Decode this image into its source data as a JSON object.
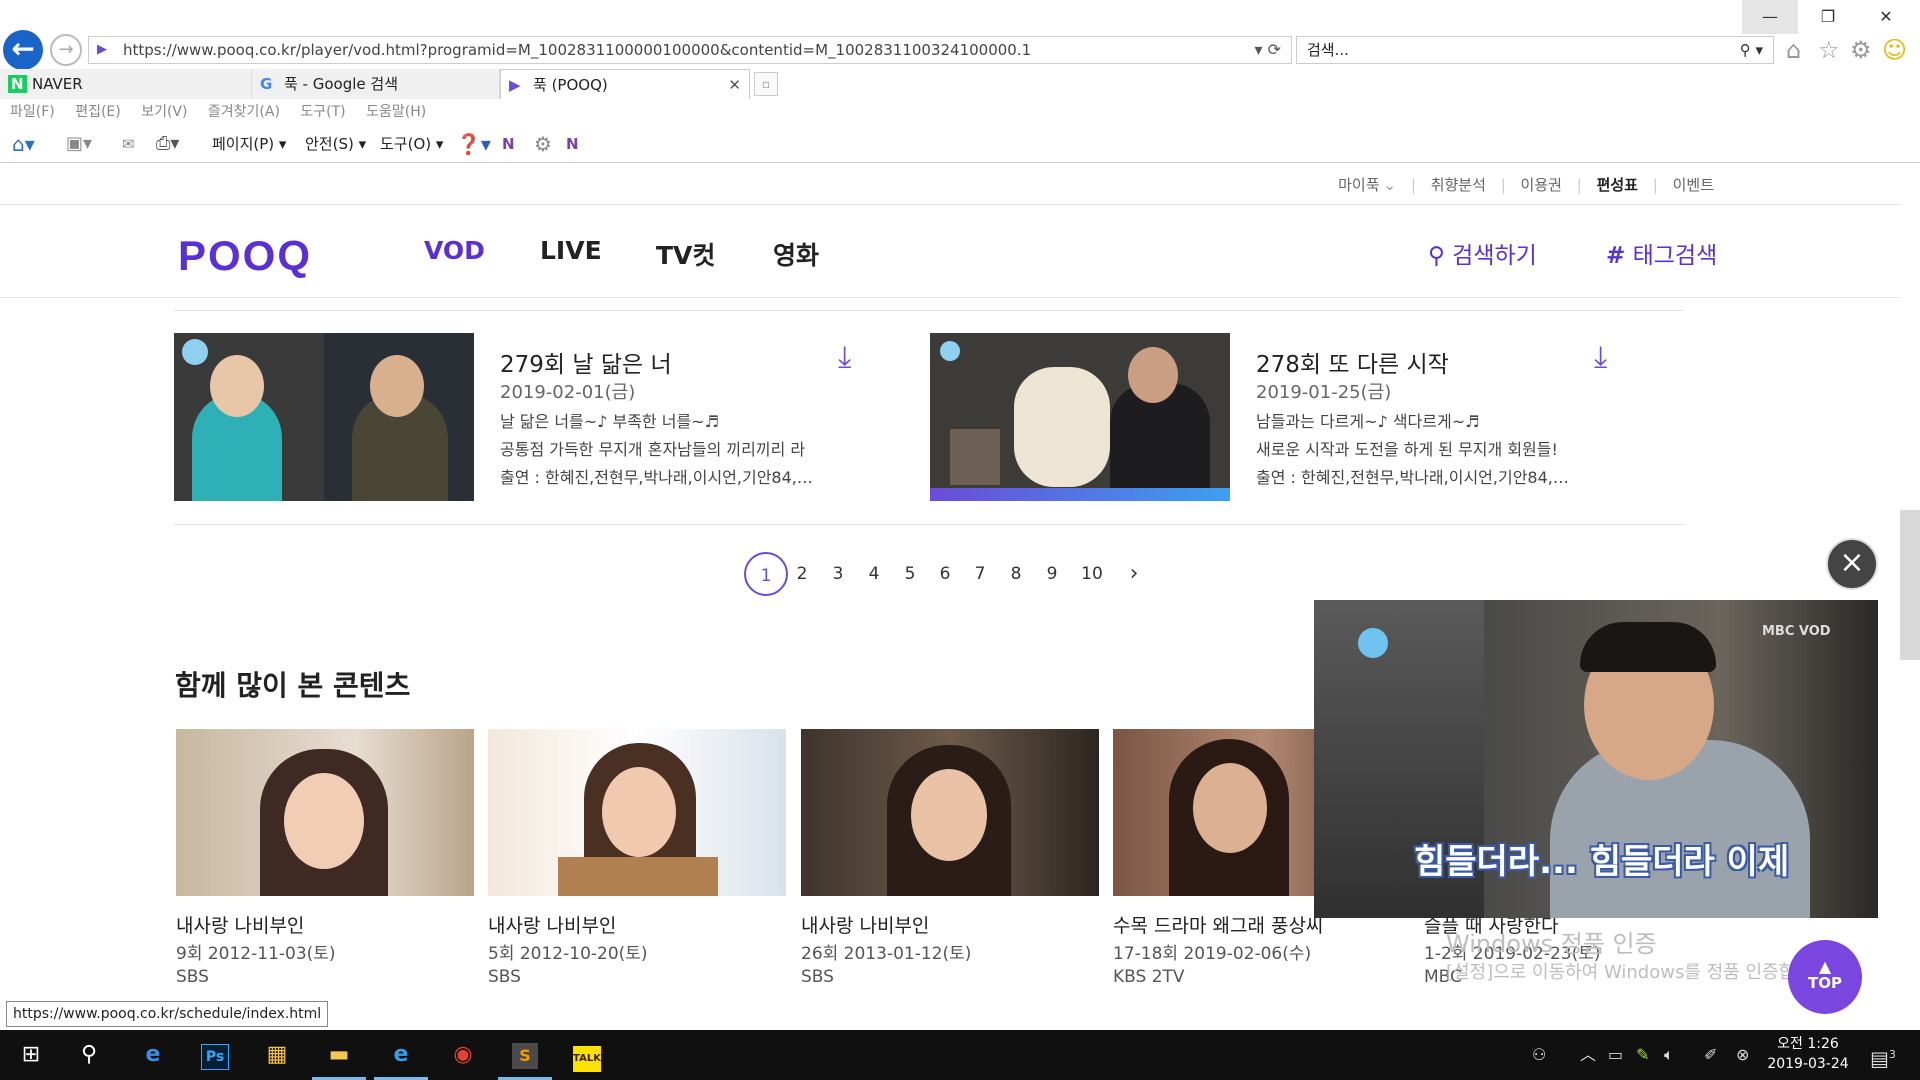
{
  "browser": {
    "url": "https://www.pooq.co.kr/player/vod.html?programid=M_1002831100000100000&contentid=M_1002831100324100000.1",
    "search_placeholder": "검색...",
    "tabs": [
      {
        "label": "NAVER",
        "icon": "naver-icon"
      },
      {
        "label": "푹 - Google 검색",
        "icon": "google-icon"
      },
      {
        "label": "푹 (POOQ)",
        "icon": "pooq-icon",
        "active": true
      }
    ],
    "menu": [
      "파일(F)",
      "편집(E)",
      "보기(V)",
      "즐겨찾기(A)",
      "도구(T)",
      "도움말(H)"
    ],
    "commands": {
      "page": "페이지(P)",
      "safety": "안전(S)",
      "tools": "도구(O)"
    }
  },
  "site": {
    "util_nav": [
      "마이푹",
      "취향분석",
      "이용권",
      "편성표",
      "이벤트"
    ],
    "logo": "POOQ",
    "gnb": [
      "VOD",
      "LIVE",
      "TV컷",
      "영화"
    ],
    "search_label": "검색하기",
    "tag_search_label": "태그검색"
  },
  "episodes": [
    {
      "title": "279회 날 닮은 너",
      "date": "2019-02-01(금)",
      "desc1": "날 닮은 너를~♪ 부족한 너를~♬",
      "desc2": "공통점 가득한 무지개 혼자남들의 끼리끼리 라",
      "cast": "출연 : 한혜진,전현무,박나래,이시언,기안84,…"
    },
    {
      "title": "278회 또 다른 시작",
      "date": "2019-01-25(금)",
      "desc1": "남들과는 다르게~♪ 색다르게~♬",
      "desc2": "새로운 시작과 도전을 하게 된 무지개 회원들!",
      "cast": "출연 : 한혜진,전현무,박나래,이시언,기안84,…"
    }
  ],
  "pagination": {
    "pages": [
      "1",
      "2",
      "3",
      "4",
      "5",
      "6",
      "7",
      "8",
      "9",
      "10"
    ],
    "current": "1",
    "next": "›"
  },
  "related": {
    "title": "함께 많이 본 콘텐츠",
    "items": [
      {
        "title": "내사랑 나비부인",
        "sub": "9회 2012-11-03(토)",
        "channel": "SBS"
      },
      {
        "title": "내사랑 나비부인",
        "sub": "5회 2012-10-20(토)",
        "channel": "SBS"
      },
      {
        "title": "내사랑 나비부인",
        "sub": "26회 2013-01-12(토)",
        "channel": "SBS"
      },
      {
        "title": "수목 드라마 왜그래 풍상씨",
        "sub": "17-18회 2019-02-06(수)",
        "channel": "KBS 2TV"
      },
      {
        "title": "슬플 때 사랑한다",
        "sub": "1-2회 2019-02-23(토)",
        "channel": "MBC"
      }
    ]
  },
  "player": {
    "subtitle": "힘들더라... 힘들더라 이제",
    "logo": "MBC VOD",
    "close": "×"
  },
  "top_button": "TOP",
  "watermark": {
    "line1": "Windows 정품 인증",
    "line2": "[설정]으로 이동하여 Windows를 정품 인증합니다."
  },
  "status_url": "https://www.pooq.co.kr/schedule/index.html",
  "taskbar": {
    "time": "오전 1:26",
    "date": "2019-03-24",
    "notifications": "3"
  },
  "colors": {
    "brand": "#5a2fd6",
    "accent": "#e03ea0"
  }
}
